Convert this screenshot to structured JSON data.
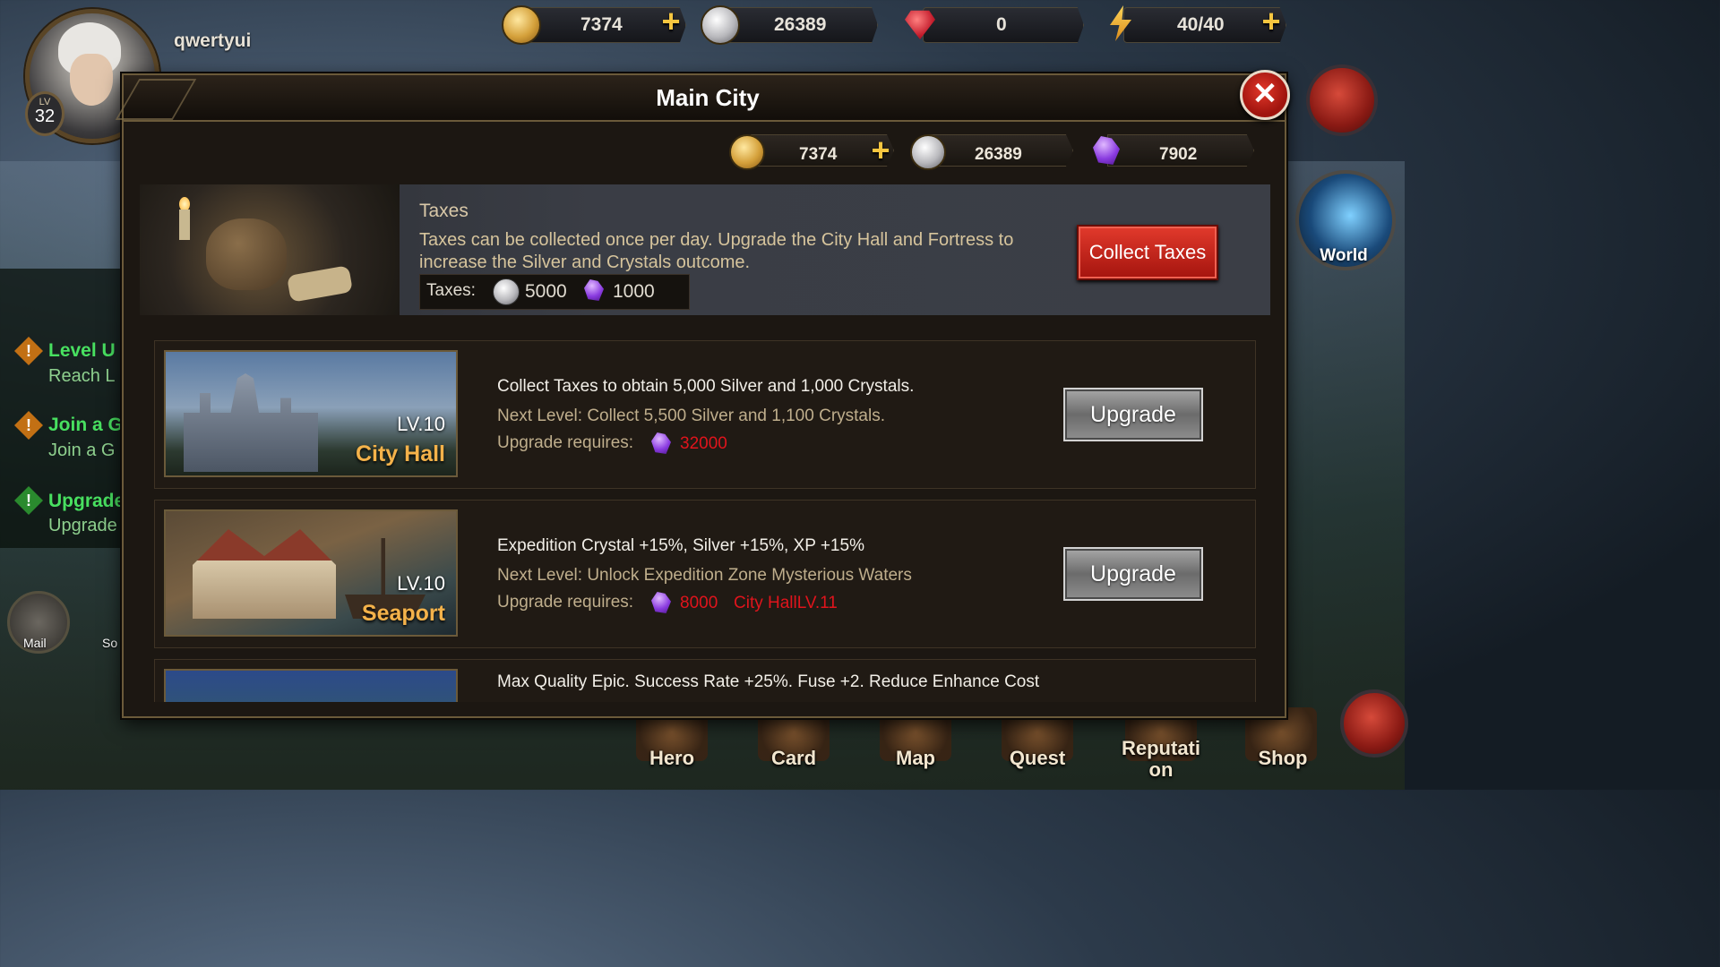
{
  "player": {
    "name": "qwertyui",
    "level_label": "LV",
    "level": "32"
  },
  "top_resources": {
    "gold": "7374",
    "silver": "26389",
    "gems": "0",
    "energy": "40/40"
  },
  "side_buttons": {
    "world_label": "World"
  },
  "quests": [
    {
      "title": "Level U",
      "sub": "Reach L"
    },
    {
      "title": "Join a G",
      "sub": "Join a G"
    },
    {
      "title": "Upgrade",
      "sub": "Upgrade"
    }
  ],
  "left_buttons": {
    "mail_label": "Mail",
    "social_label": "So"
  },
  "bottom_nav": [
    "Hero",
    "Card",
    "Map",
    "Quest",
    "Reputati\non",
    "Shop"
  ],
  "modal": {
    "title": "Main City",
    "resources": {
      "gold": "7374",
      "silver": "26389",
      "crystals": "7902"
    },
    "taxes": {
      "title": "Taxes",
      "description": "Taxes can be collected once per day. Upgrade the City Hall and Fortress to increase the Silver and Crystals outcome.",
      "amount_label": "Taxes:",
      "silver_amount": "5000",
      "crystal_amount": "1000",
      "collect_label": "Collect Taxes"
    },
    "buildings": [
      {
        "name": "City Hall",
        "level": "LV.10",
        "description": "Collect Taxes to obtain 5,000 Silver and 1,000 Crystals.",
        "next_level": "Next Level: Collect 5,500 Silver and 1,100 Crystals.",
        "req_label": "Upgrade requires:",
        "req_crystals": "32000",
        "req_extra": "",
        "upgrade_label": "Upgrade"
      },
      {
        "name": "Seaport",
        "level": "LV.10",
        "description": "Expedition Crystal +15%, Silver +15%, XP +15%",
        "next_level": "Next Level: Unlock Expedition Zone Mysterious Waters",
        "req_label": "Upgrade requires:",
        "req_crystals": "8000",
        "req_extra": "City HallLV.11",
        "upgrade_label": "Upgrade"
      },
      {
        "description": "Max Quality Epic. Success Rate +25%. Fuse +2. Reduce Enhance Cost"
      }
    ]
  },
  "colors": {
    "accent_gold": "#f4b24a",
    "requirement_red": "#e0141c",
    "quest_green": "#48e060",
    "button_red": "#c21c14"
  }
}
